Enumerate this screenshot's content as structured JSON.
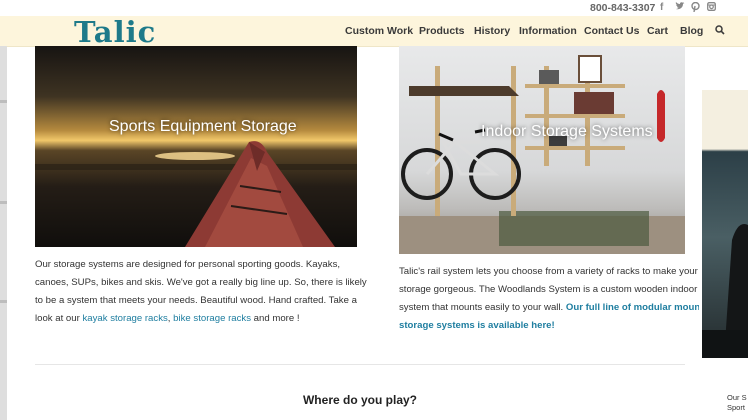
{
  "header": {
    "phone": "800-843-3307",
    "logo": "Talic",
    "social_icons": [
      "facebook-icon",
      "twitter-icon",
      "pinterest-icon",
      "instagram-icon"
    ],
    "nav": [
      "Custom Work",
      "Products",
      "History",
      "Information",
      "Contact Us",
      "Cart",
      "Blog"
    ],
    "search_icon": "search-icon"
  },
  "cards": [
    {
      "title": "Sports Equipment Storage",
      "desc_lines": [
        "Our storage systems are designed for personal sporting goods.  Kayaks,",
        "canoes, SUPs, bikes and skis. We've got a really big line up. So, there is likely",
        "to be a system that meets your needs. Beautiful wood. Hand crafted. Take a"
      ],
      "desc_last_prefix": "look at our ",
      "link_kayak": "kayak storage racks",
      "sep": ", ",
      "link_bike": "bike storage racks",
      "desc_suffix": " and more !"
    },
    {
      "title": "Indoor Storage Systems",
      "desc_lines": [
        "Talic's rail system lets you choose from a variety of racks to make your",
        "storage gorgeous. The Woodlands System is a custom wooden indoor"
      ],
      "desc_line3_prefix": "system that mounts easily to your wall. ",
      "link_line3": "Our full line of modular moun",
      "link_line4": "storage systems is available here!"
    },
    {
      "side_text_lines": [
        "Our S",
        "Sport"
      ]
    }
  ],
  "section_heading": "Where do you play?",
  "colors": {
    "brand": "#1e7a8a",
    "header_bg": "#fdf5dc",
    "link": "#1f7ea0"
  }
}
